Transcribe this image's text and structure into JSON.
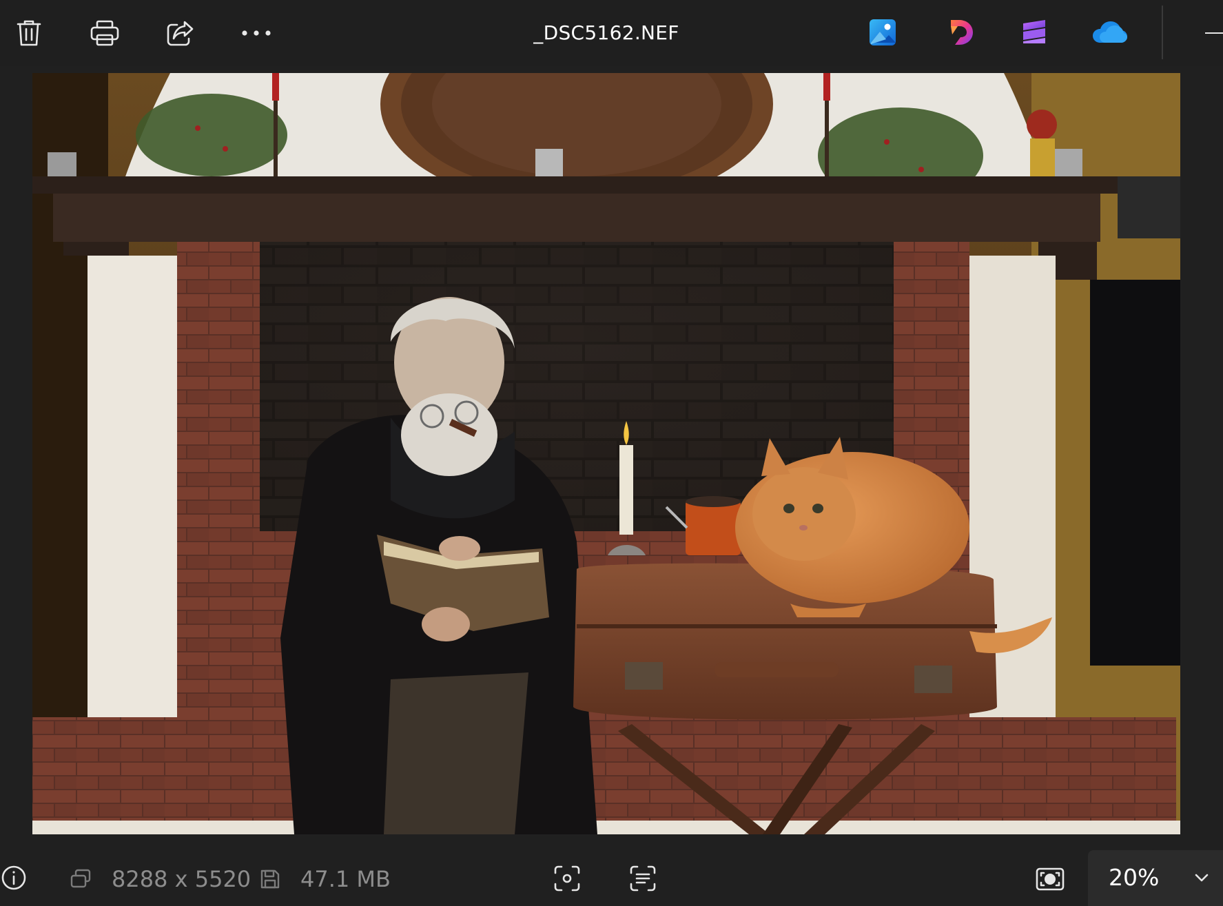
{
  "window": {
    "title": "_DSC5162.NEF"
  },
  "toolbar": {
    "left_actions": [
      {
        "name": "delete",
        "icon": "trash-icon"
      },
      {
        "name": "print",
        "icon": "printer-icon"
      },
      {
        "name": "share",
        "icon": "share-icon"
      },
      {
        "name": "more",
        "icon": "more-horizontal-icon"
      }
    ],
    "app_launchers": [
      {
        "name": "photos-editor",
        "icon": "photos-app-icon"
      },
      {
        "name": "designer",
        "icon": "designer-app-icon"
      },
      {
        "name": "clipchamp",
        "icon": "clipchamp-app-icon"
      },
      {
        "name": "onedrive",
        "icon": "onedrive-icon"
      }
    ],
    "minimize_icon": "minimize-icon"
  },
  "image": {
    "alt": "Elderly bearded man reading a book beside a fireplace while an orange cat sits on a vintage suitcase table"
  },
  "statusbar": {
    "info_icon": "info-icon",
    "resolution_icon": "resolution-icon",
    "resolution": "8288 x 5520",
    "filesize_icon": "save-disk-icon",
    "filesize": "47.1 MB",
    "visual_search_icon": "visual-search-icon",
    "text_scan_icon": "text-scan-icon",
    "fit_icon": "fit-to-window-icon",
    "zoom": "20%",
    "zoom_dropdown_icon": "chevron-down-icon"
  },
  "colors": {
    "background": "#202020",
    "toolbar": "#1f1f1f",
    "zoom_box": "#2b2b2b",
    "muted_text": "#8d8d8d"
  }
}
